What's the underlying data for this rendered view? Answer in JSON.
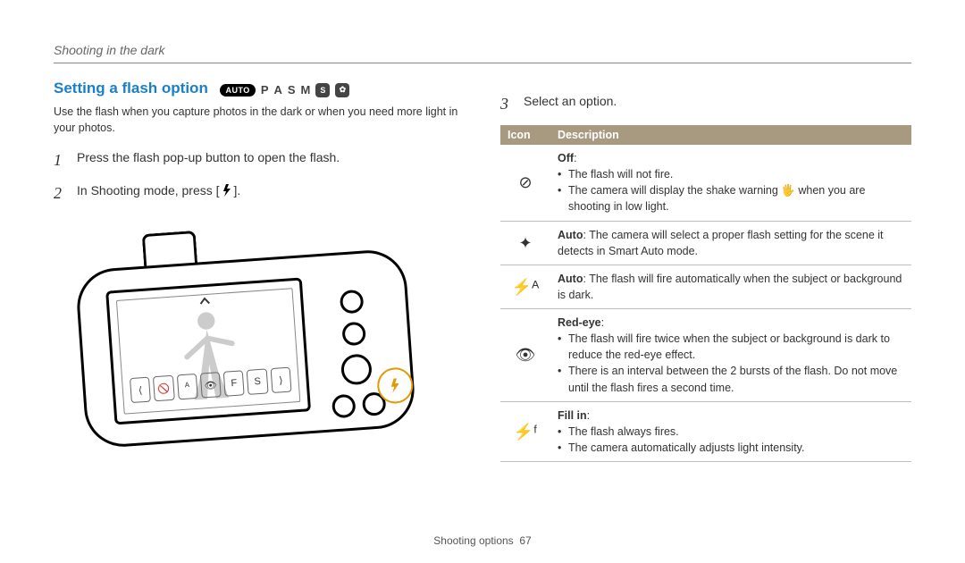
{
  "breadcrumb": "Shooting in the dark",
  "title": "Setting a flash option",
  "mode_icons": {
    "auto_pill": "AUTO",
    "letters": [
      "P",
      "A",
      "S",
      "M"
    ],
    "badge_s": "S",
    "badge_star": "✿"
  },
  "intro": "Use the flash when you capture photos in the dark or when you need more light in your photos.",
  "steps": [
    {
      "num": "1",
      "text_before": "Press the flash pop-up button to open the flash.",
      "icon": null,
      "text_after": ""
    },
    {
      "num": "2",
      "text_before": "In Shooting mode, press [",
      "icon": "flash",
      "text_after": "]."
    },
    {
      "num": "3",
      "text_before": "Select an option.",
      "icon": null,
      "text_after": ""
    }
  ],
  "option_strip": [
    "⟨",
    "🚫",
    "ᴬ",
    "👁",
    "F",
    "S",
    "⟩"
  ],
  "table": {
    "headers": {
      "icon": "Icon",
      "desc": "Description"
    },
    "rows": [
      {
        "icon_name": "flash-off-icon",
        "icon_glyph": "⊘",
        "title": "Off",
        "bullets": [
          "The flash will not fire.",
          "The camera will display the shake warning 🖐 when you are shooting in low light."
        ]
      },
      {
        "icon_name": "smart-auto-icon",
        "icon_glyph": "✦",
        "title_inline": "Auto",
        "inline_text": ": The camera will select a proper flash setting for the scene it detects in Smart Auto mode."
      },
      {
        "icon_name": "flash-auto-icon",
        "icon_glyph": "⚡ᴬ",
        "title_inline": "Auto",
        "inline_text": ": The flash will fire automatically when the subject or background is dark."
      },
      {
        "icon_name": "red-eye-icon",
        "icon_glyph": "👁",
        "title": "Red-eye",
        "bullets": [
          "The flash will fire twice when the subject or background is dark to reduce the red-eye effect.",
          "There is an interval between the 2 bursts of the flash. Do not move until the flash fires a second time."
        ]
      },
      {
        "icon_name": "fill-in-icon",
        "icon_glyph": "⚡ᶠ",
        "title": "Fill in",
        "bullets": [
          "The flash always fires.",
          "The camera automatically adjusts light intensity."
        ]
      }
    ]
  },
  "footer": {
    "section": "Shooting options",
    "page": "67"
  }
}
